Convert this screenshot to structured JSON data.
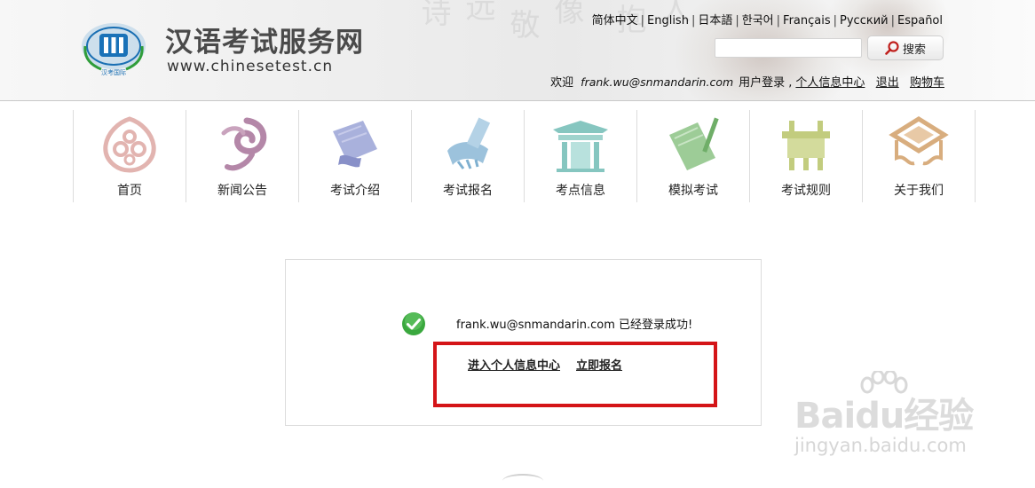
{
  "header": {
    "logo_cn": "汉语考试服务网",
    "logo_url": "www.chinesetest.cn",
    "emblem_text": "汉考国际",
    "languages": [
      "简体中文",
      "English",
      "日本語",
      "한국어",
      "Français",
      "Русский",
      "Español"
    ],
    "search": {
      "value": "",
      "placeholder": "",
      "button_label": "搜索"
    },
    "user_bar": {
      "welcome": "欢迎",
      "email": "frank.wu@snmandarin.com",
      "login_label": "用户登录 ,",
      "profile_link": "个人信息中心",
      "logout_link": "退出",
      "cart_link": "购物车"
    }
  },
  "nav": {
    "items": [
      {
        "label": "首页",
        "icon": "home-icon",
        "color": "#e2b4b0"
      },
      {
        "label": "新闻公告",
        "icon": "news-icon",
        "color": "#b487a8"
      },
      {
        "label": "考试介绍",
        "icon": "scroll-icon",
        "color": "#9aa3d6"
      },
      {
        "label": "考试报名",
        "icon": "register-icon",
        "color": "#9cc2dc"
      },
      {
        "label": "考点信息",
        "icon": "pavilion-icon",
        "color": "#86c6c0"
      },
      {
        "label": "模拟考试",
        "icon": "mock-exam-icon",
        "color": "#9dcc97"
      },
      {
        "label": "考试规则",
        "icon": "ding-vessel-icon",
        "color": "#c2cc7e"
      },
      {
        "label": "关于我们",
        "icon": "about-icon",
        "color": "#d8ad7e"
      }
    ]
  },
  "message": {
    "text": "frank.wu@snmandarin.com 已经登录成功!",
    "link_profile": "进入个人信息中心",
    "link_register": "立即报名"
  },
  "watermark": {
    "brand": "Baidu经验",
    "url": "jingyan.baidu.com"
  },
  "colors": {
    "highlight": "#d41418",
    "success": "#3aa83e"
  }
}
